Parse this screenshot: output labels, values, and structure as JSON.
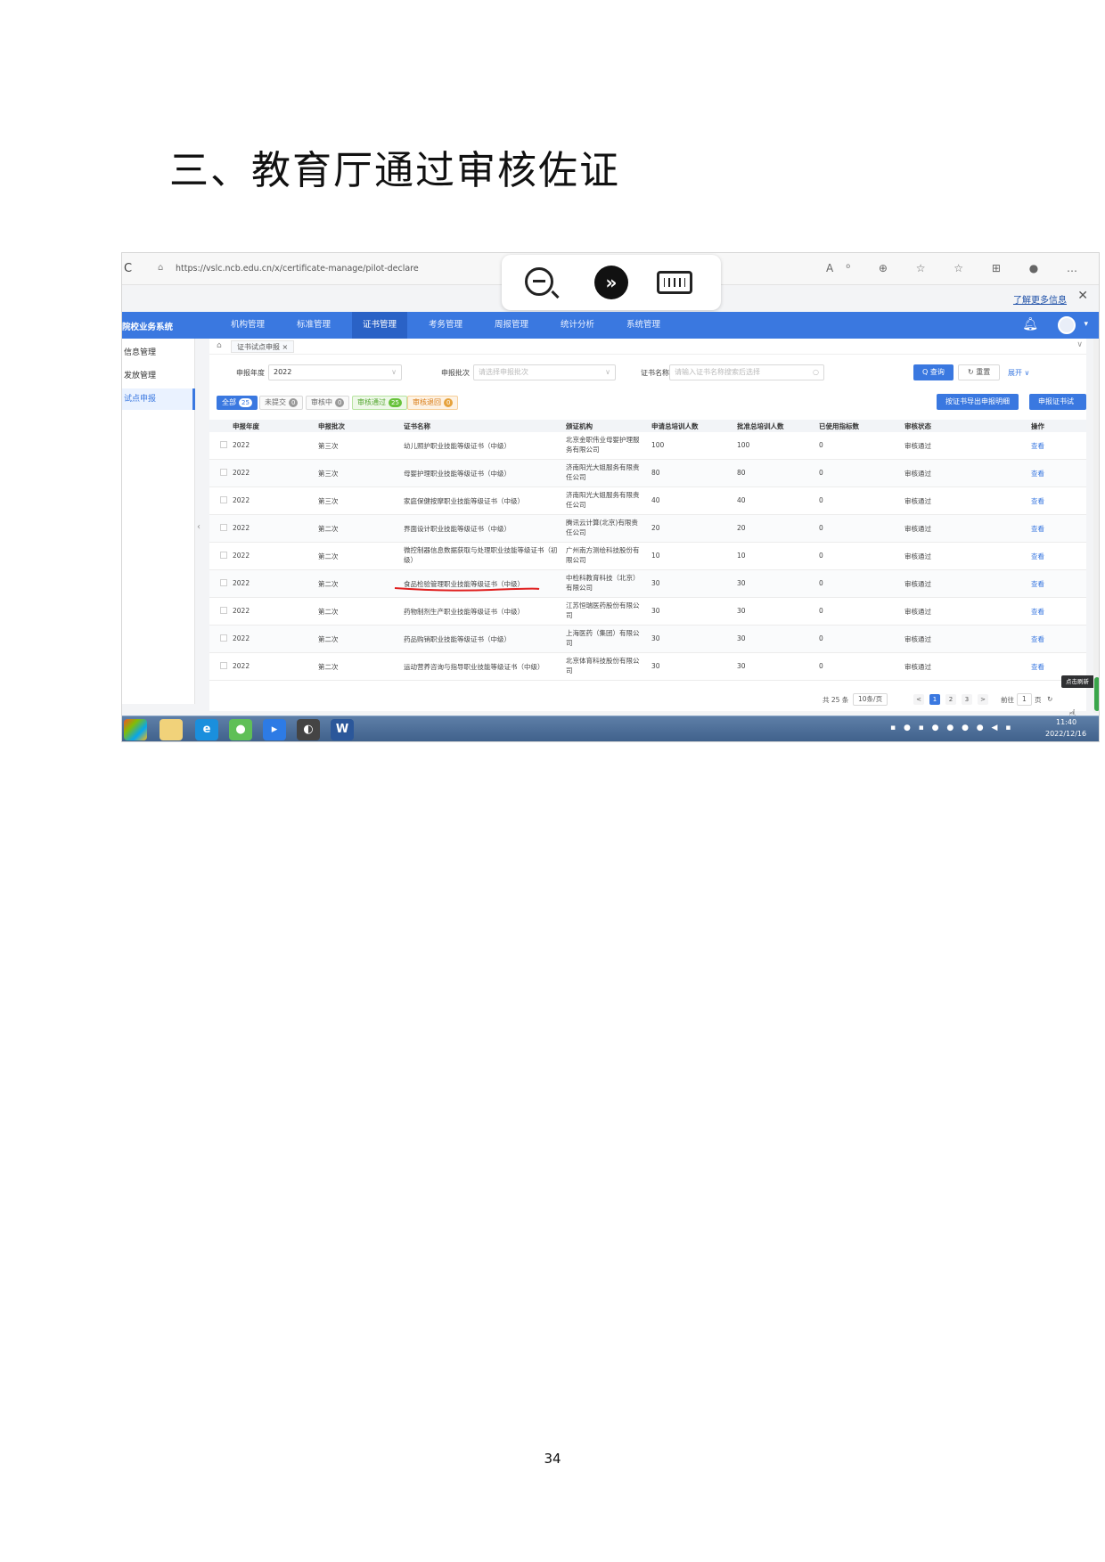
{
  "heading": "三、教育厅通过审核佐证",
  "page_number": "34",
  "browser": {
    "url": "https://vslc.ncb.edu.cn/x/certificate-manage/pilot-declare",
    "learn_more": "了解更多信息",
    "close_glyph": "✕",
    "reload_glyph": "C",
    "lock_glyph": "⌂",
    "icons_glyph": "A⁰ ⊕ ☆ ☆ ⊞ ● …"
  },
  "app": {
    "system_name": "院校业务系统",
    "nav": [
      "机构管理",
      "标准管理",
      "证书管理",
      "考务管理",
      "周报管理",
      "统计分析",
      "系统管理"
    ],
    "nav_active": 2,
    "sidebar": [
      "信息管理",
      "发放管理",
      "试点申报"
    ],
    "sidebar_active": 2,
    "tab_label": "证书试点申报 ×"
  },
  "filters": {
    "year_label": "申报年度",
    "year_value": "2022",
    "batch_label": "申报批次",
    "batch_placeholder": "请选择申报批次",
    "cert_label": "证书名称",
    "cert_placeholder": "请输入证书名称搜索后选择",
    "search_button": "Q 查询",
    "reset_button": "↻ 重置",
    "expand_link": "展开 ∨"
  },
  "status_chips": [
    {
      "label": "全部",
      "count": "25"
    },
    {
      "label": "未提交",
      "count": "0"
    },
    {
      "label": "审核中",
      "count": "0"
    },
    {
      "label": "审核通过",
      "count": "25"
    },
    {
      "label": "审核退回",
      "count": "0"
    }
  ],
  "actions": {
    "export_button": "按证书导出申报明细",
    "declare_button": "申报证书试点"
  },
  "table": {
    "columns": [
      "申报年度",
      "申报批次",
      "证书名称",
      "颁证机构",
      "申请总培训人数",
      "批准总培训人数",
      "已使用指标数",
      "审核状态",
      "操作"
    ],
    "rows": [
      [
        "2022",
        "第三次",
        "幼儿照护职业技能等级证书（中级）",
        "北京金职伟业母婴护理服务有限公司",
        "100",
        "100",
        "0",
        "审核通过",
        "查看"
      ],
      [
        "2022",
        "第三次",
        "母婴护理职业技能等级证书（中级）",
        "济南阳光大姐服务有限责任公司",
        "80",
        "80",
        "0",
        "审核通过",
        "查看"
      ],
      [
        "2022",
        "第三次",
        "家庭保健按摩职业技能等级证书（中级）",
        "济南阳光大姐服务有限责任公司",
        "40",
        "40",
        "0",
        "审核通过",
        "查看"
      ],
      [
        "2022",
        "第二次",
        "界面设计职业技能等级证书（中级）",
        "腾讯云计算(北京)有限责任公司",
        "20",
        "20",
        "0",
        "审核通过",
        "查看"
      ],
      [
        "2022",
        "第二次",
        "微控制器信息数据获取与处理职业技能等级证书（初级）",
        "广州南方测绘科技股份有限公司",
        "10",
        "10",
        "0",
        "审核通过",
        "查看"
      ],
      [
        "2022",
        "第二次",
        "食品检验管理职业技能等级证书（中级）",
        "中检科教育科技（北京）有限公司",
        "30",
        "30",
        "0",
        "审核通过",
        "查看"
      ],
      [
        "2022",
        "第二次",
        "药物制剂生产职业技能等级证书（中级）",
        "江苏恒瑞医药股份有限公司",
        "30",
        "30",
        "0",
        "审核通过",
        "查看"
      ],
      [
        "2022",
        "第二次",
        "药品购销职业技能等级证书（中级）",
        "上海医药（集团）有限公司",
        "30",
        "30",
        "0",
        "审核通过",
        "查看"
      ],
      [
        "2022",
        "第二次",
        "运动营养咨询与指导职业技能等级证书（中级）",
        "北京体育科技股份有限公司",
        "30",
        "30",
        "0",
        "审核通过",
        "查看"
      ]
    ]
  },
  "pager": {
    "total": "共 25 条",
    "page_size": "10条/页",
    "pages": [
      "1",
      "2",
      "3"
    ],
    "active_page": "1",
    "prev": "<",
    "next": ">",
    "goto_label": "前往",
    "goto_value": "1",
    "goto_suffix": "页"
  },
  "tooltip": "点击刷新数据",
  "taskbar": {
    "time": "11:40",
    "date": "2022/12/16"
  },
  "colors": {
    "primary": "#3a78e0",
    "success": "#67c23a",
    "warning": "#e6a23c",
    "underline": "#e02020"
  }
}
